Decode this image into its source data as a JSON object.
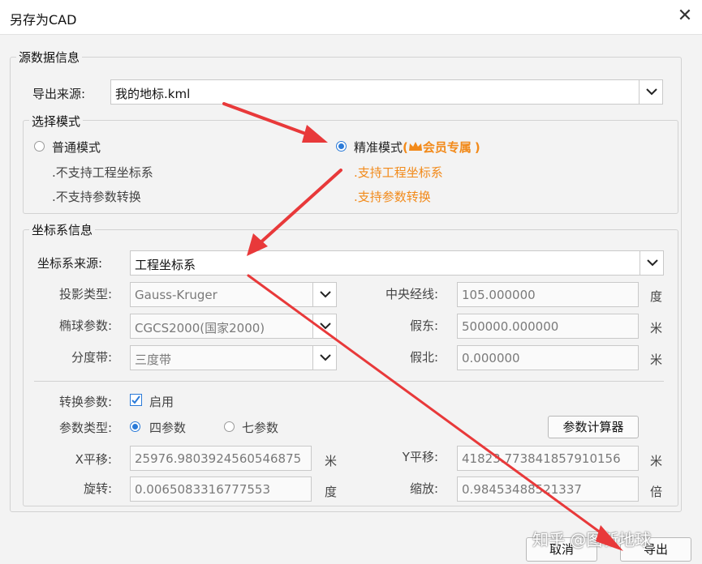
{
  "window": {
    "title": "另存为CAD",
    "close_icon": "close-icon"
  },
  "source_group": {
    "legend": "源数据信息",
    "export_label": "导出来源:",
    "export_value": "我的地标.kml"
  },
  "mode_group": {
    "legend": "选择模式",
    "normal": {
      "label": "普通模式",
      "selected": false,
      "line1": ".不支持工程坐标系",
      "line2": ".不支持参数转换"
    },
    "precise": {
      "label": "精准模式",
      "vip_open": "(",
      "vip_text": "会员专属",
      "vip_close": ")",
      "selected": true,
      "line1": ".支持工程坐标系",
      "line2": ".支持参数转换"
    }
  },
  "crs_group": {
    "legend": "坐标系信息",
    "crs_source_label": "坐标系来源:",
    "crs_source_value": "工程坐标系",
    "projection_label": "投影类型:",
    "projection_value": "Gauss-Kruger",
    "ellipsoid_label": "椭球参数:",
    "ellipsoid_value": "CGCS2000(国家2000)",
    "zone_label": "分度带:",
    "zone_value": "三度带",
    "central_meridian_label": "中央经线:",
    "central_meridian_value": "105.000000",
    "central_meridian_unit": "度",
    "false_east_label": "假东:",
    "false_east_value": "500000.000000",
    "false_east_unit": "米",
    "false_north_label": "假北:",
    "false_north_value": "0.000000",
    "false_north_unit": "米",
    "transform_label": "转换参数:",
    "transform_enabled": true,
    "transform_enable_text": "启用",
    "param_type_label": "参数类型:",
    "four_param": {
      "label": "四参数",
      "selected": true
    },
    "seven_param": {
      "label": "七参数",
      "selected": false
    },
    "calc_button": "参数计算器",
    "x_shift_label": "X平移:",
    "x_shift_value": "25976.9803924560546875",
    "x_shift_unit": "米",
    "y_shift_label": "Y平移:",
    "y_shift_value": "41823.773841857910156",
    "y_shift_unit": "米",
    "rotation_label": "旋转:",
    "rotation_value": "0.0065083316777553",
    "rotation_unit": "度",
    "scale_label": "缩放:",
    "scale_value": "0.98453488521337",
    "scale_unit": "倍"
  },
  "footer": {
    "cancel": "取消",
    "export": "导出"
  },
  "watermark": "知乎 @图新地球",
  "colors": {
    "accent": "#2a7ad8",
    "vip": "#f28a1a",
    "arrow": "#e8393a"
  }
}
